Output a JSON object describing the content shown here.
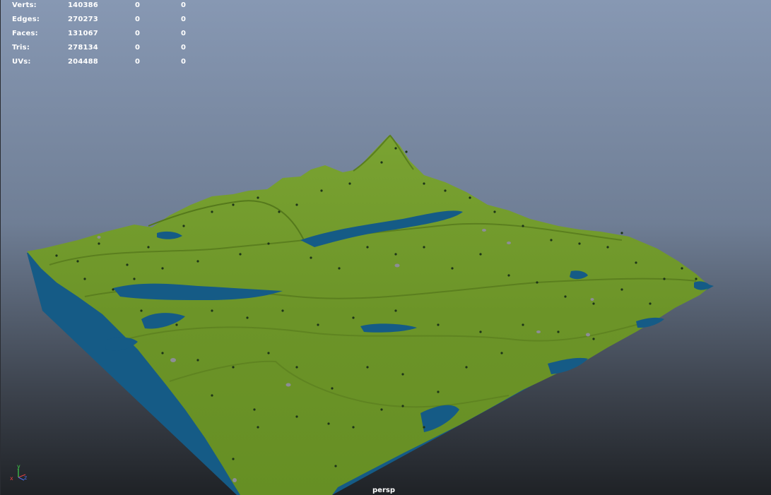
{
  "hud": {
    "rows": [
      {
        "label": "Verts:",
        "total": "140386",
        "selected": "0",
        "component": "0"
      },
      {
        "label": "Edges:",
        "total": "270273",
        "selected": "0",
        "component": "0"
      },
      {
        "label": "Faces:",
        "total": "131067",
        "selected": "0",
        "component": "0"
      },
      {
        "label": "Tris:",
        "total": "278134",
        "selected": "0",
        "component": "0"
      },
      {
        "label": "UVs:",
        "total": "204488",
        "selected": "0",
        "component": "0"
      }
    ]
  },
  "viewport": {
    "camera": "persp"
  },
  "axis": {
    "x": "x",
    "y": "y",
    "z": "z"
  },
  "colors": {
    "grass": "#6f9a2a",
    "grass_dark": "#56791d",
    "water": "#145a85",
    "tree": "#1e3a1a",
    "rock": "#8a8a92"
  },
  "icons": [
    "axis-gizmo-icon"
  ]
}
